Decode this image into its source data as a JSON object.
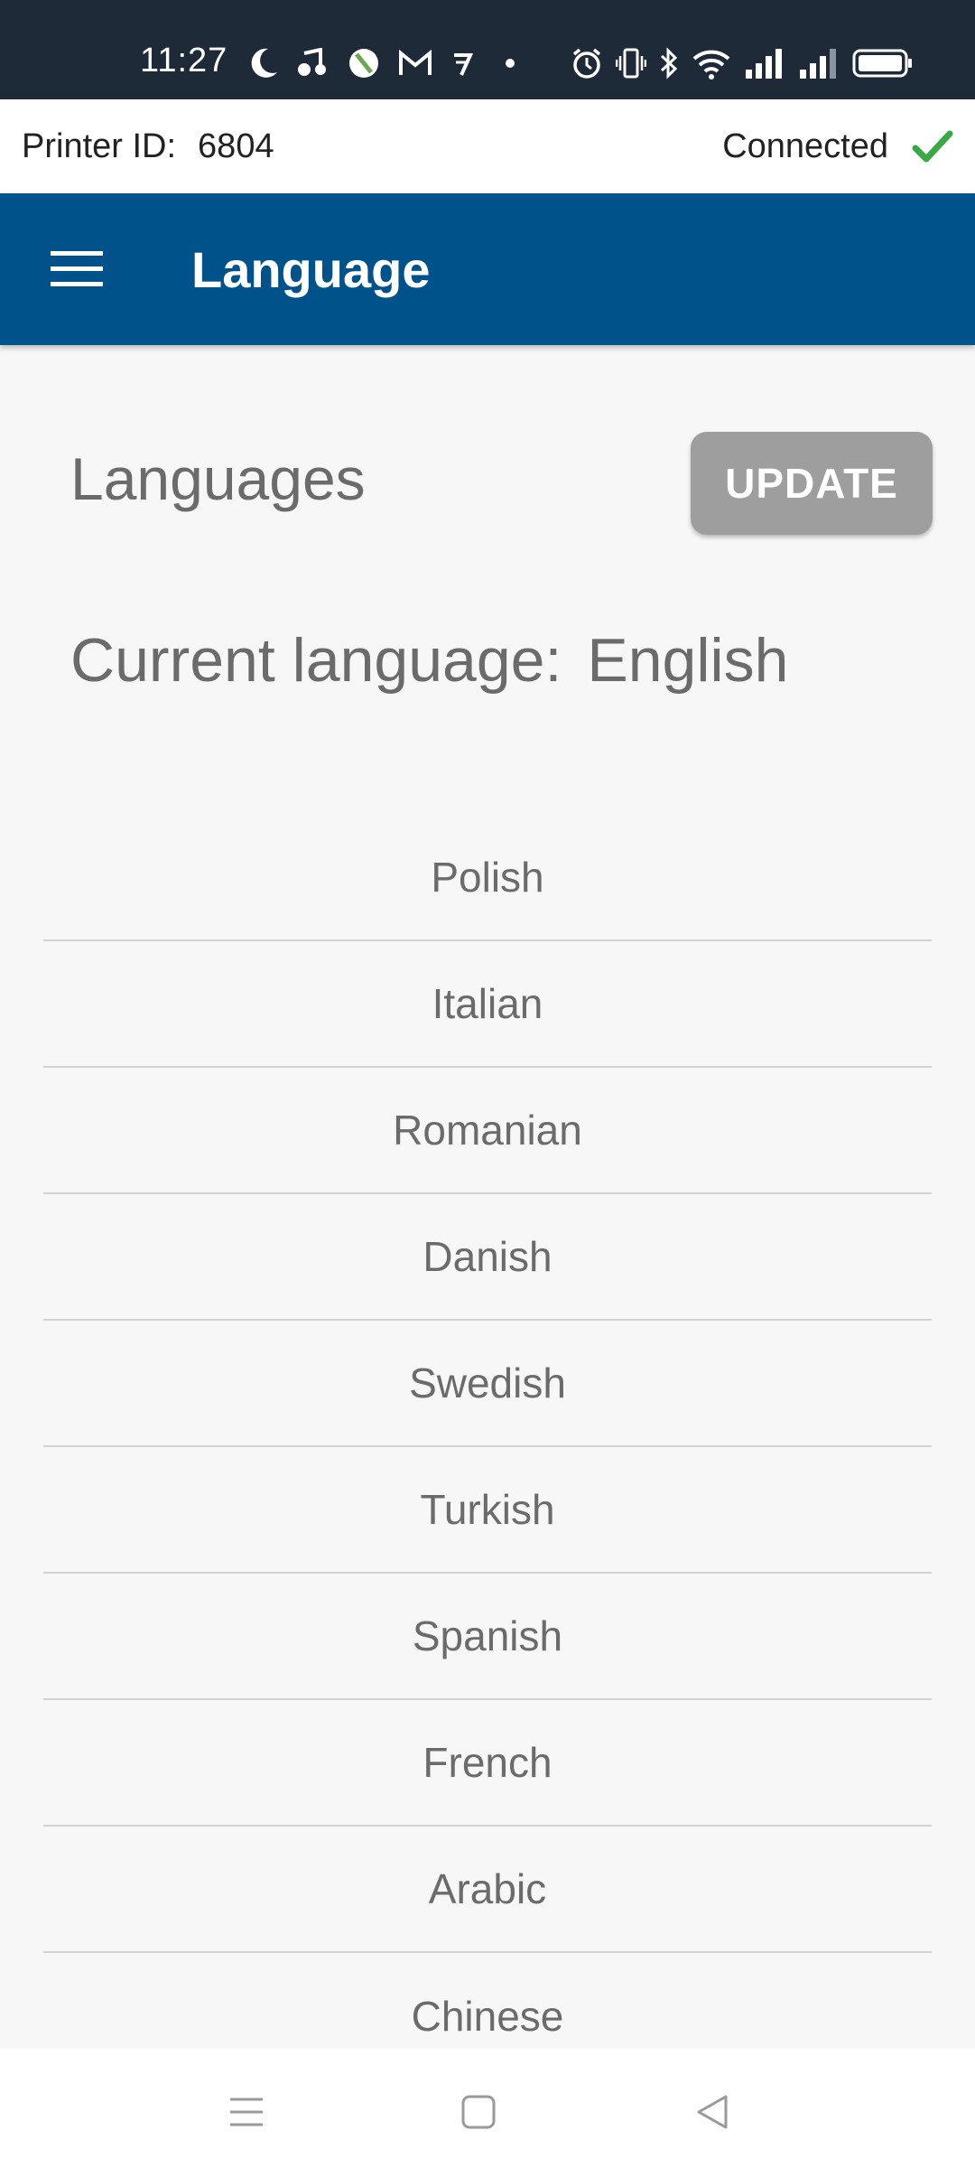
{
  "status_bar": {
    "time": "11:27",
    "left_icons": [
      "moon-icon",
      "music-icon",
      "maps-icon",
      "gmail-icon",
      "app-icon",
      "dot-icon"
    ],
    "right_icons": [
      "alarm-icon",
      "vibrate-icon",
      "bluetooth-icon",
      "wifi-icon",
      "signal-icon",
      "signal-icon",
      "battery-icon"
    ]
  },
  "printer_bar": {
    "id_label": "Printer ID:",
    "id_value": "6804",
    "status": "Connected",
    "status_color": "#3aa845"
  },
  "app_bar": {
    "title": "Language",
    "color": "#00528a"
  },
  "main": {
    "heading": "Languages",
    "update_label": "UPDATE",
    "current_label": "Current language:",
    "current_value": "English",
    "languages": [
      "Polish",
      "Italian",
      "Romanian",
      "Danish",
      "Swedish",
      "Turkish",
      "Spanish",
      "French",
      "Arabic",
      "Chinese"
    ]
  },
  "nav": {
    "icons": [
      "recents-icon",
      "home-icon",
      "back-icon"
    ]
  }
}
